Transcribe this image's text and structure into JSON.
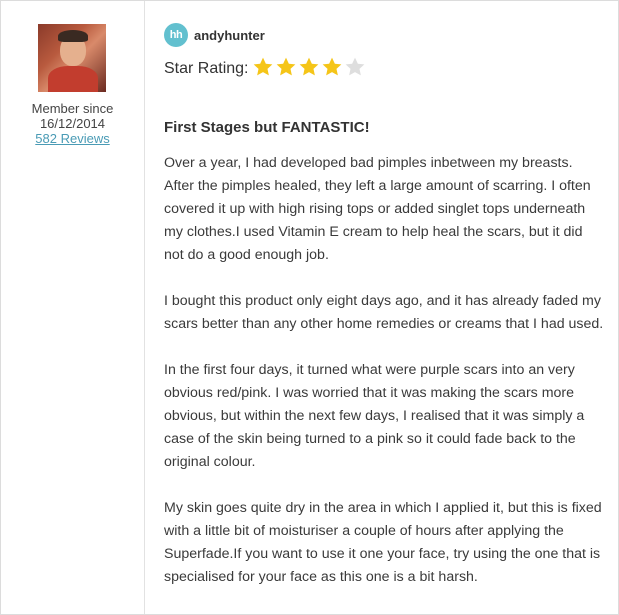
{
  "reviewer": {
    "member_since_label": "Member since",
    "member_since_date": "16/12/2014",
    "reviews_link": "582 Reviews"
  },
  "review": {
    "username": "andyhunter",
    "badge_text": "hh",
    "star_label": "Star Rating:",
    "rating": 4,
    "max_rating": 5,
    "title": "First Stages but FANTASTIC!",
    "paragraphs": [
      "Over a year, I had developed bad pimples inbetween my breasts. After the pimples healed, they left a large amount of scarring. I often covered it up with high rising tops or added singlet tops underneath my clothes.I used Vitamin E cream to help heal the scars, but it did not do a good enough job.",
      "I bought this product only eight days ago, and it has already faded my scars better than any other home remedies or creams that I had used.",
      "In the first four days, it turned what were purple scars into an very obvious red/pink. I was worried that it was making the scars more obvious, but within the next few days, I realised that it was simply a case of the skin being turned to a pink so it could fade back to the original colour.",
      "My skin goes quite dry in the area in which I applied it, but this is fixed with a little bit of moisturiser a couple of hours after applying the Superfade.If you want to use it one your face, try using the one that is specialised for your face as this one is a bit harsh."
    ]
  },
  "colors": {
    "star_filled": "#f5c518",
    "star_empty": "#dedede",
    "link": "#4a9bb5",
    "badge": "#62c0cf"
  }
}
